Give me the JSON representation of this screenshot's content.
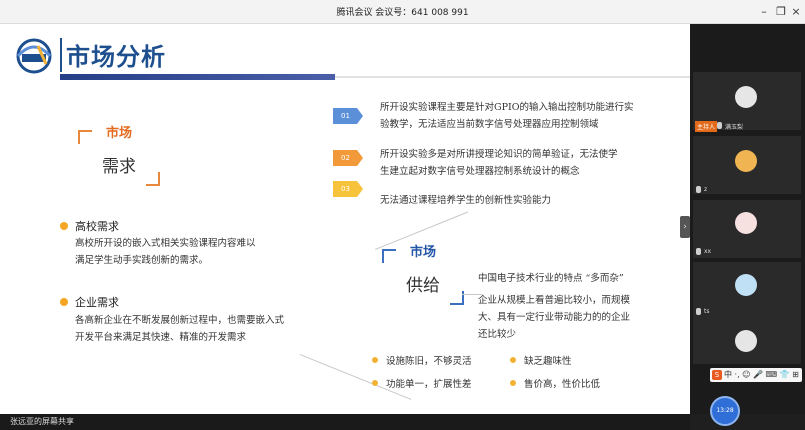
{
  "window": {
    "title": "腾讯会议 会议号：641 008 991",
    "buttons": [
      "–",
      "❐",
      "×"
    ]
  },
  "slide": {
    "title": "市场分析",
    "demand": {
      "tag": "市场",
      "heading": "需求",
      "items": [
        {
          "label": "高校需求",
          "text_lines": [
            "高校所开设的嵌入式相关实验课程内容难以",
            "满足学生动手实践创新的需求。"
          ]
        },
        {
          "label": "企业需求",
          "text_lines": [
            "各高新企业在不断发展创新过程中，也需要嵌入式",
            "开发平台来满足其快速、精准的开发需求"
          ]
        }
      ]
    },
    "numbered": [
      {
        "num": "01",
        "color": "#5b8fd8",
        "lines": [
          "所开设实验课程主要是针对GPIO的输入输出控制功能进行实",
          "验教学，无法适应当前数字信号处理器应用控制领域"
        ]
      },
      {
        "num": "02",
        "color": "#f29a3a",
        "lines": [
          "所开设实验多是对所讲授理论知识的简单验证，无法使学",
          "生建立起对数字信号处理器控制系统设计的概念"
        ]
      },
      {
        "num": "03",
        "color": "#f6c33a",
        "lines": [
          "无法通过课程培养学生的创新性实验能力"
        ]
      }
    ],
    "supply": {
      "tag": "市场",
      "heading": "供给",
      "industry": "中国电子技术行业的特点 “多而杂”",
      "industry_lines": [
        "企业从规模上看普遍比较小，而规模",
        "大、具有一定行业带动能力的的企业",
        "还比较少"
      ],
      "bullets": [
        [
          "设施陈旧，不够灵活",
          "缺乏趣味性"
        ],
        [
          "功能单一，扩展性差",
          "售价高，性价比低"
        ]
      ]
    }
  },
  "participants": [
    {
      "name": "满玉梨",
      "host_tag": "主持人",
      "avatar": "person-icon"
    },
    {
      "name": "z",
      "avatar": "cartoon-icon"
    },
    {
      "name": "xx",
      "avatar": "girl-icon"
    },
    {
      "name": "ts",
      "avatar": "mask-icon"
    },
    {
      "name": "",
      "avatar": "person-icon"
    }
  ],
  "ime": {
    "label": "S",
    "text": "中 ·, ☺ 🎤 ⌨ 👕 ⊞"
  },
  "timer": "13:28",
  "share_status": "张远亚的屏幕共享",
  "colors": {
    "title_blue": "#1d4f8f",
    "accent_orange": "#e46b1f",
    "dot_yellow": "#f5a623"
  }
}
